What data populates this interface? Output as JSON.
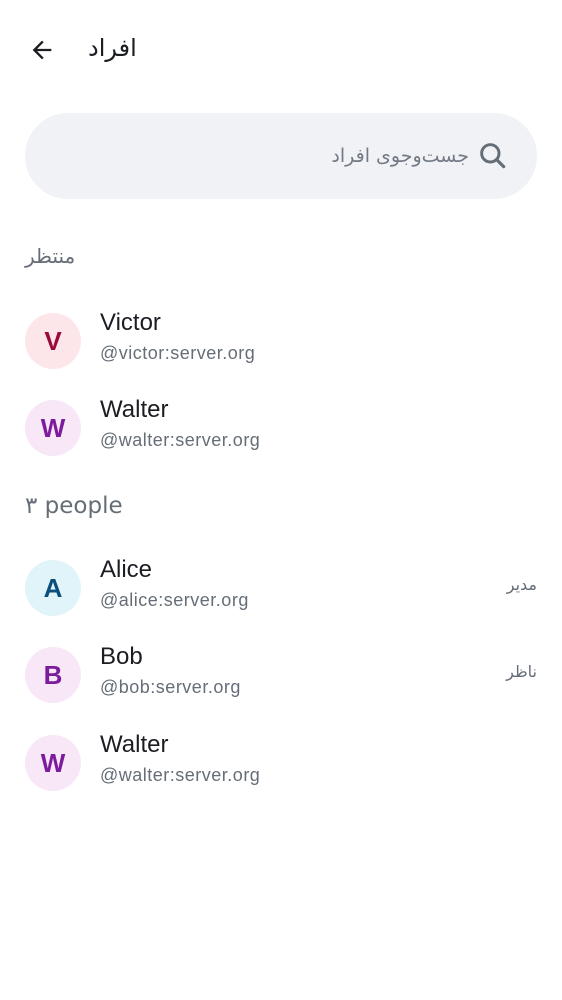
{
  "header": {
    "title": "افراد",
    "back_icon": "arrow-left-icon"
  },
  "search": {
    "placeholder": "جست‌وجوی افراد",
    "value": "",
    "icon": "search-icon"
  },
  "pending": {
    "label": "منتظر",
    "members": [
      {
        "initial": "V",
        "name": "Victor",
        "id": "@victor:server.org",
        "avatar_bg": "#fde6ea",
        "avatar_fg": "#9b0a3c"
      },
      {
        "initial": "W",
        "name": "Walter",
        "id": "@walter:server.org",
        "avatar_bg": "#f8e7f7",
        "avatar_fg": "#7c1c9c"
      }
    ]
  },
  "joined": {
    "label": "۳ people",
    "members": [
      {
        "initial": "A",
        "name": "Alice",
        "id": "@alice:server.org",
        "role": "مدیر",
        "avatar_bg": "#e1f4fa",
        "avatar_fg": "#0b4f7c"
      },
      {
        "initial": "B",
        "name": "Bob",
        "id": "@bob:server.org",
        "role": "ناظر",
        "avatar_bg": "#f8e7f7",
        "avatar_fg": "#7c1c9c"
      },
      {
        "initial": "W",
        "name": "Walter",
        "id": "@walter:server.org",
        "role": "",
        "avatar_bg": "#f8e7f7",
        "avatar_fg": "#7c1c9c"
      }
    ]
  }
}
